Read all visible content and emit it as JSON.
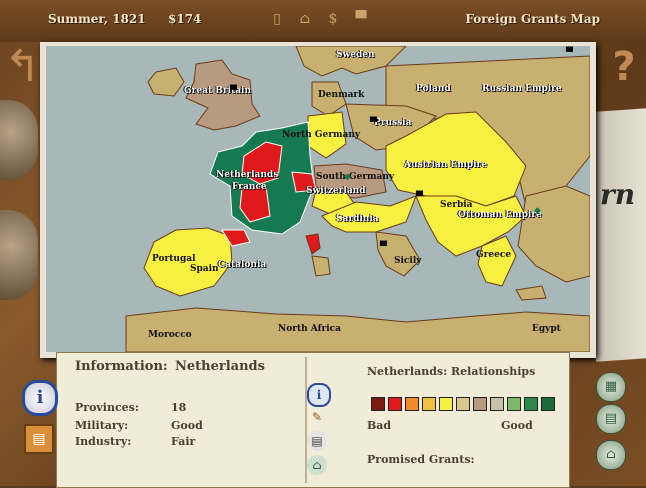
{
  "header": {
    "season": "Summer, 1821",
    "money": "$174",
    "title": "Foreign Grants Map"
  },
  "nav": {
    "back_icon": "back-arrow-icon",
    "help_label": "?"
  },
  "map_labels": [
    {
      "text": "Sweden",
      "style": "dark"
    },
    {
      "text": "Great Britain",
      "style": "white"
    },
    {
      "text": "Denmark",
      "style": "dark"
    },
    {
      "text": "Poland",
      "style": "white"
    },
    {
      "text": "Russian Empire",
      "style": "white"
    },
    {
      "text": "Prussia",
      "style": "white"
    },
    {
      "text": "North Germany",
      "style": "dark"
    },
    {
      "text": "Netherlands",
      "style": "white"
    },
    {
      "text": "France",
      "style": "white"
    },
    {
      "text": "South Germany",
      "style": "dark"
    },
    {
      "text": "Switzerland",
      "style": "white"
    },
    {
      "text": "Austrian Empire",
      "style": "white"
    },
    {
      "text": "Serbia",
      "style": "dark"
    },
    {
      "text": "Ottoman Empire",
      "style": "white"
    },
    {
      "text": "Sardinia",
      "style": "white"
    },
    {
      "text": "Portugal",
      "style": "dark"
    },
    {
      "text": "Spain",
      "style": "dark"
    },
    {
      "text": "Catalonia",
      "style": "white"
    },
    {
      "text": "Sicily",
      "style": "dark"
    },
    {
      "text": "Greece",
      "style": "dark"
    },
    {
      "text": "Morocco",
      "style": "dark"
    },
    {
      "text": "North Africa",
      "style": "dark"
    },
    {
      "text": "Egypt",
      "style": "dark"
    }
  ],
  "info": {
    "label": "Information:",
    "value": "Netherlands",
    "stats": [
      {
        "label": "Provinces:",
        "value": "18"
      },
      {
        "label": "Military:",
        "value": "Good"
      },
      {
        "label": "Industry:",
        "value": "Fair"
      }
    ]
  },
  "relationships": {
    "title": "Netherlands: Relationships",
    "scale_colors": [
      "#7a1a10",
      "#e01a1a",
      "#f08a2a",
      "#f0c040",
      "#f4f040",
      "#d8c890",
      "#b89a80",
      "#c8c0a8",
      "#7ab86a",
      "#2a8a4a",
      "#1a6a3a"
    ],
    "bad_label": "Bad",
    "good_label": "Good",
    "promised_label": "Promised Grants:"
  },
  "colors": {
    "sea": "#a8b8b8",
    "neutral": "#c8b070",
    "russia": "#c8b070",
    "yellow": "#f8f040",
    "green": "#157a52",
    "red": "#e01a1a",
    "tan": "#b89a80"
  }
}
